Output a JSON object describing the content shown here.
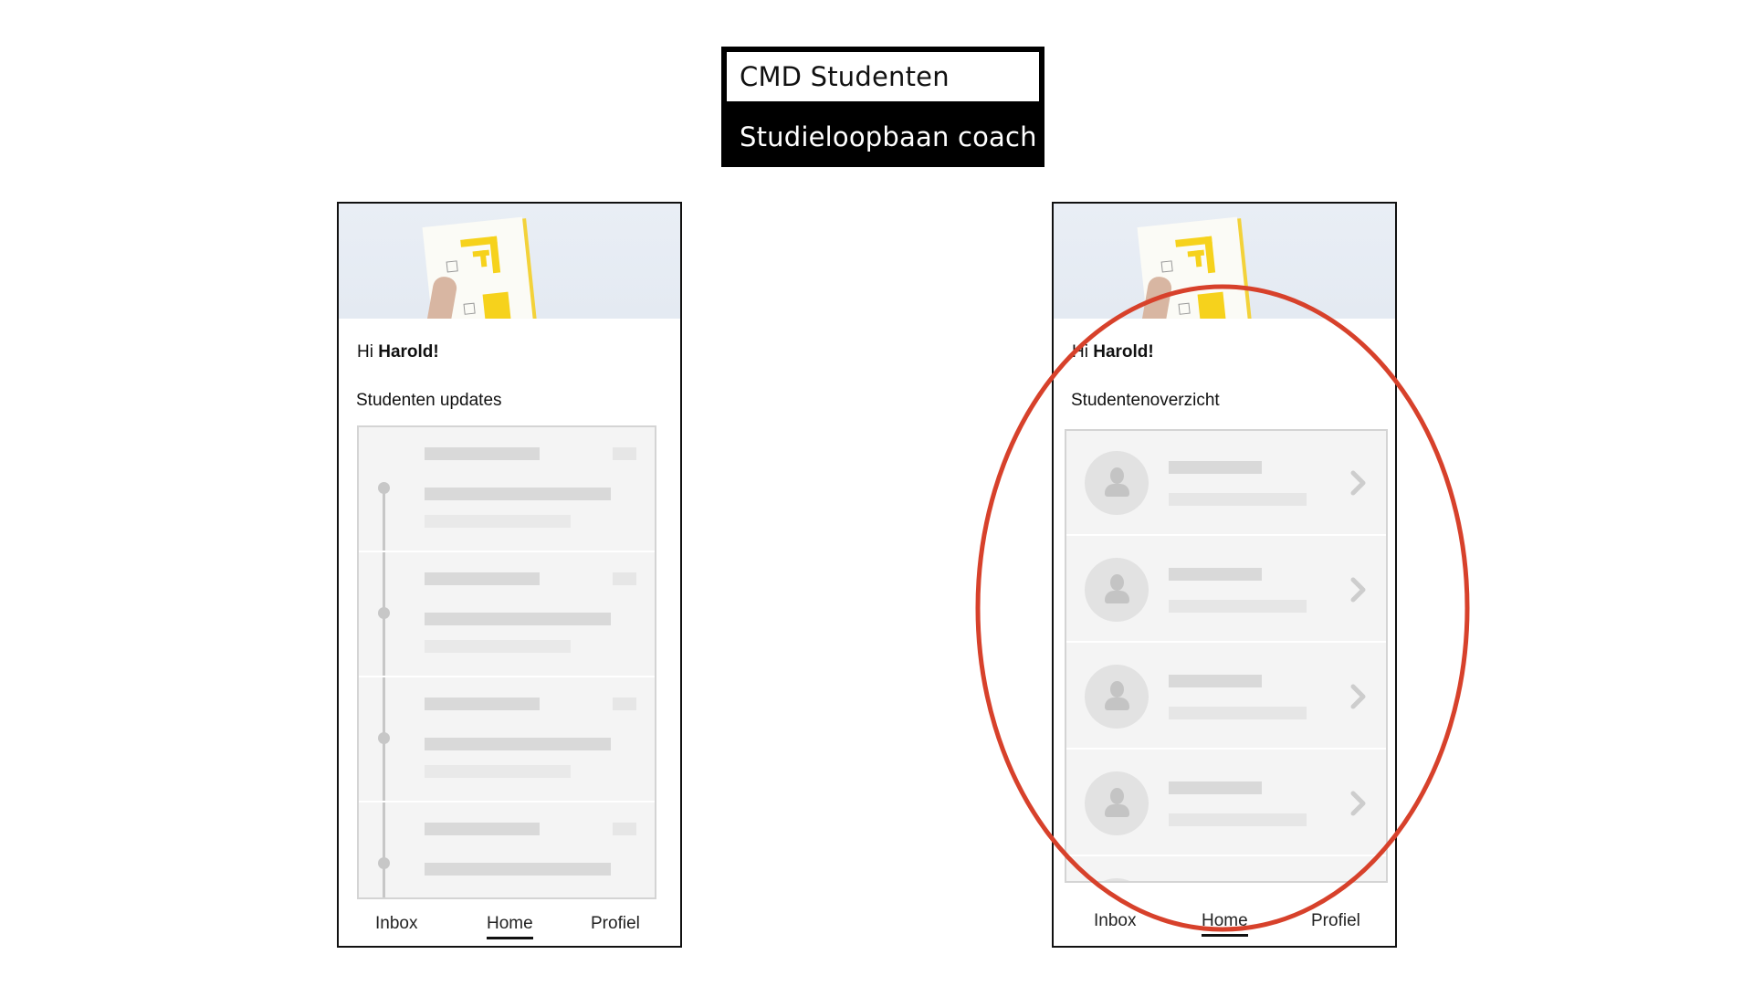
{
  "role_switch": {
    "active_label": "CMD Studenten",
    "inactive_label": "Studieloopbaan coach"
  },
  "screens": {
    "left": {
      "greeting_prefix": "Hi ",
      "greeting_name": "Harold!",
      "section_title": "Studenten updates",
      "nav": {
        "inbox": "Inbox",
        "home": "Home",
        "profile": "Profiel",
        "active": "Home"
      }
    },
    "right": {
      "greeting_prefix": "Hi ",
      "greeting_name": "Harold!",
      "section_title": "Studentenoverzicht",
      "nav": {
        "inbox": "Inbox",
        "home": "Home",
        "profile": "Profiel",
        "active": "Home"
      }
    }
  },
  "icons": {
    "avatar": "user-avatar-icon",
    "chevron": "chevron-right-icon",
    "timeline_dot": "timeline-dot-icon"
  },
  "colors": {
    "annotation": "#d7412b",
    "placeholder": "#d9d9d9",
    "hero_accent": "#f6d21c"
  }
}
